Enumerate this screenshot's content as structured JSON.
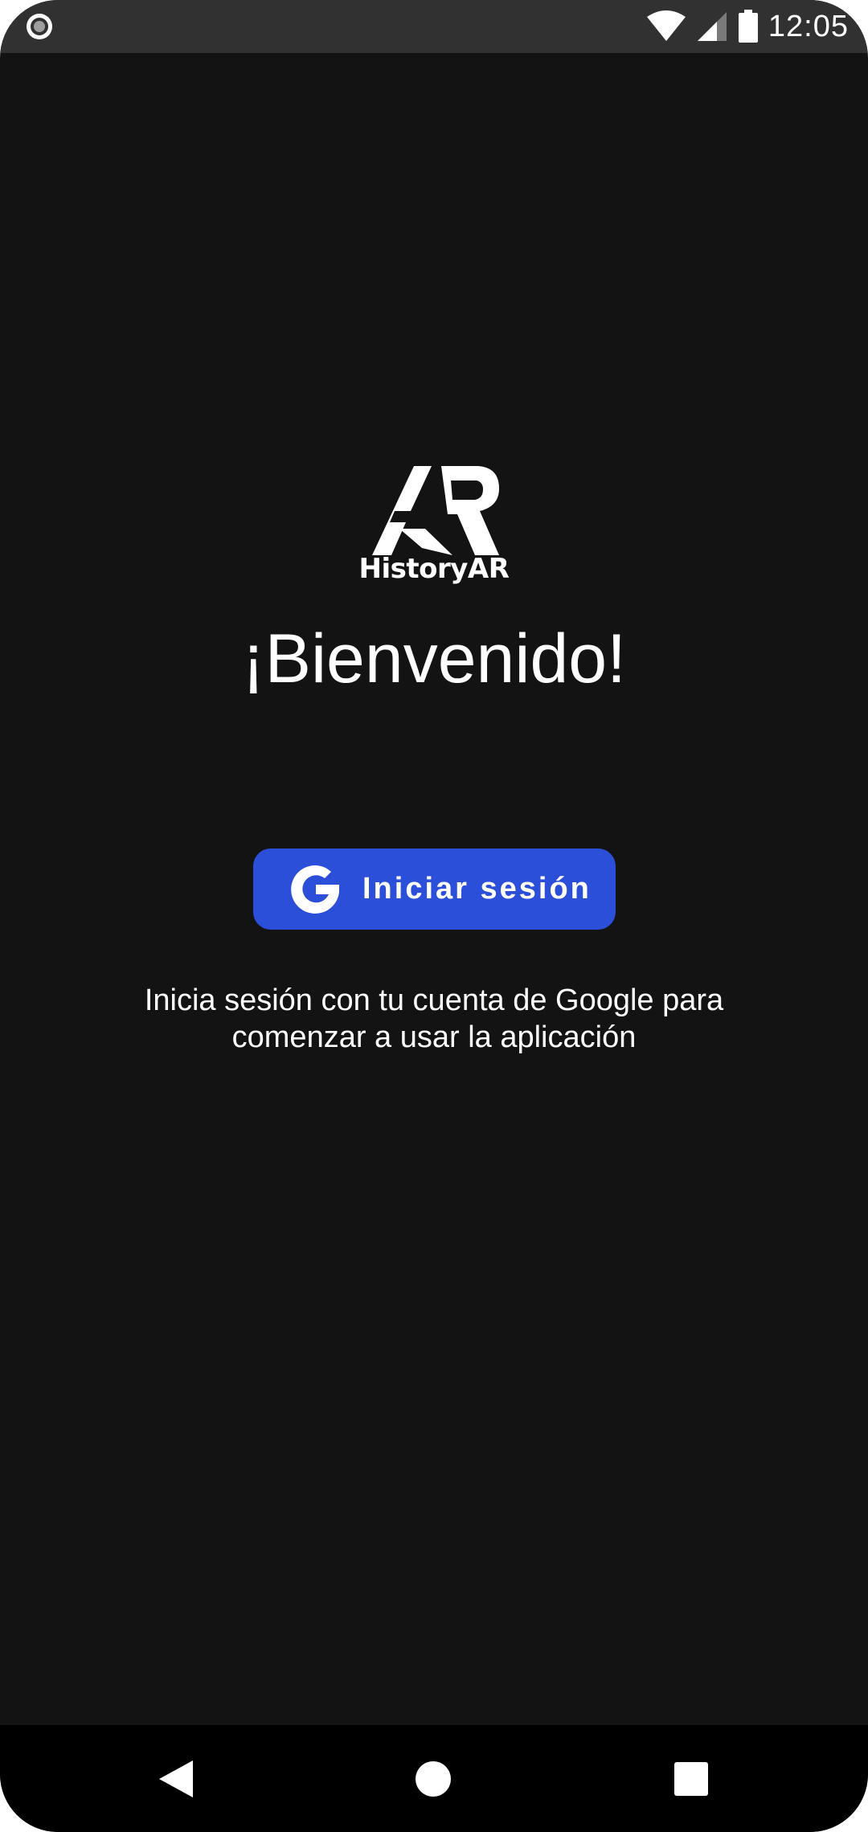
{
  "status_bar": {
    "time": "12:05",
    "icons": [
      "record-icon",
      "wifi-icon",
      "cellular-signal-icon",
      "battery-icon"
    ]
  },
  "logo": {
    "wordmark": "HistoryAR"
  },
  "welcome": {
    "title": "¡Bienvenido!"
  },
  "signin": {
    "label": "Iniciar sesión",
    "icon": "google-icon",
    "color": "#2c4fd9"
  },
  "description": {
    "line1": "Inicia sesión con tu cuenta de Google para",
    "line2": "comenzar a usar la aplicación"
  },
  "nav_bar": {
    "icons": [
      "back-icon",
      "home-icon",
      "recents-icon"
    ]
  },
  "colors": {
    "background": "#131313",
    "status_bar": "#313131",
    "nav_bar": "#000000",
    "text": "#ffffff"
  }
}
